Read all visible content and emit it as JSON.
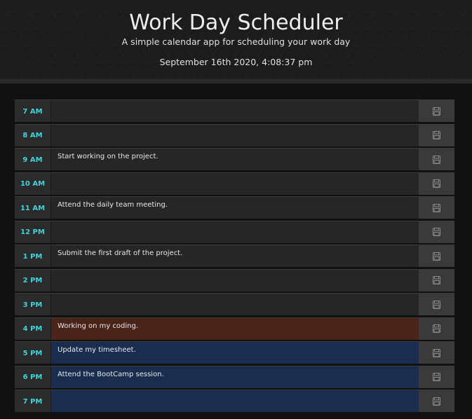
{
  "header": {
    "title": "Work Day Scheduler",
    "subtitle": "A simple calendar app for scheduling your work day",
    "current_date": "September 16th 2020, 4:08:37 pm"
  },
  "colors": {
    "hour_text": "#3fd3da",
    "past": "#262626",
    "present": "#4a2418",
    "future": "#1a2d4f",
    "save_bg": "#3a3a3a"
  },
  "save_icon": "floppy-disk-icon",
  "rows": [
    {
      "hour": "7 AM",
      "text": "",
      "state": "past"
    },
    {
      "hour": "8 AM",
      "text": "",
      "state": "past"
    },
    {
      "hour": "9 AM",
      "text": "Start working on the project.",
      "state": "past"
    },
    {
      "hour": "10 AM",
      "text": "",
      "state": "past"
    },
    {
      "hour": "11 AM",
      "text": "Attend the daily team meeting.",
      "state": "past"
    },
    {
      "hour": "12 PM",
      "text": "",
      "state": "past"
    },
    {
      "hour": "1 PM",
      "text": "Submit the first draft of the project.",
      "state": "past"
    },
    {
      "hour": "2 PM",
      "text": "",
      "state": "past"
    },
    {
      "hour": "3 PM",
      "text": "",
      "state": "past"
    },
    {
      "hour": "4 PM",
      "text": "Working on my coding.",
      "state": "present"
    },
    {
      "hour": "5 PM",
      "text": "Update my timesheet.",
      "state": "future"
    },
    {
      "hour": "6 PM",
      "text": "Attend the BootCamp session.",
      "state": "future"
    },
    {
      "hour": "7 PM",
      "text": "",
      "state": "future"
    }
  ]
}
